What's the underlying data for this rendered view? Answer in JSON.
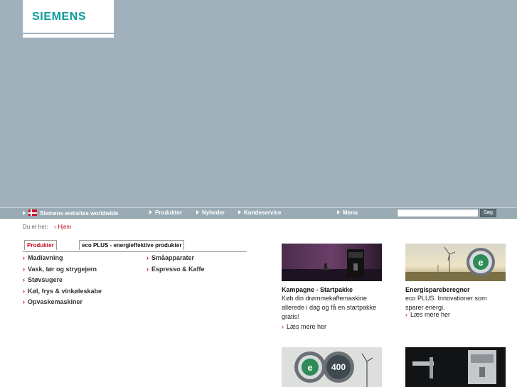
{
  "brand": {
    "logo_text": "SIEMENS",
    "color": "#079a9b"
  },
  "nav": {
    "worldwide": "Siemens websites worldwide",
    "items": [
      "Produkter",
      "Nyheder",
      "Kundeservice"
    ],
    "menu": "Menu",
    "search_button": "Søg",
    "search_value": ""
  },
  "breadcrumb": {
    "label": "Du er her:",
    "home": "Hjem"
  },
  "tabs": [
    "Produkter",
    "eco PLUS - energieffektive produkter"
  ],
  "categories": {
    "col1": [
      "Madlavning",
      "Vask, tør og strygejern",
      "Støvsugere",
      "Køl, frys & vinkøleskabe",
      "Opvaskemaskiner"
    ],
    "col2": [
      "Småapparater",
      "Espresso & Kaffe"
    ]
  },
  "promos": [
    {
      "title": "Kampagne - Startpakke",
      "text_lines": [
        "Køb din drømmekaffemaskine",
        "allerede i dag og få en startpakke",
        "gratis!"
      ],
      "link": "Læs mere her"
    },
    {
      "title": "Energispareberegner",
      "text_lines": [
        "eco PLUS. Innovationer som",
        "sparer energi."
      ],
      "link": "Læs mere her"
    }
  ],
  "badge_text": "400"
}
